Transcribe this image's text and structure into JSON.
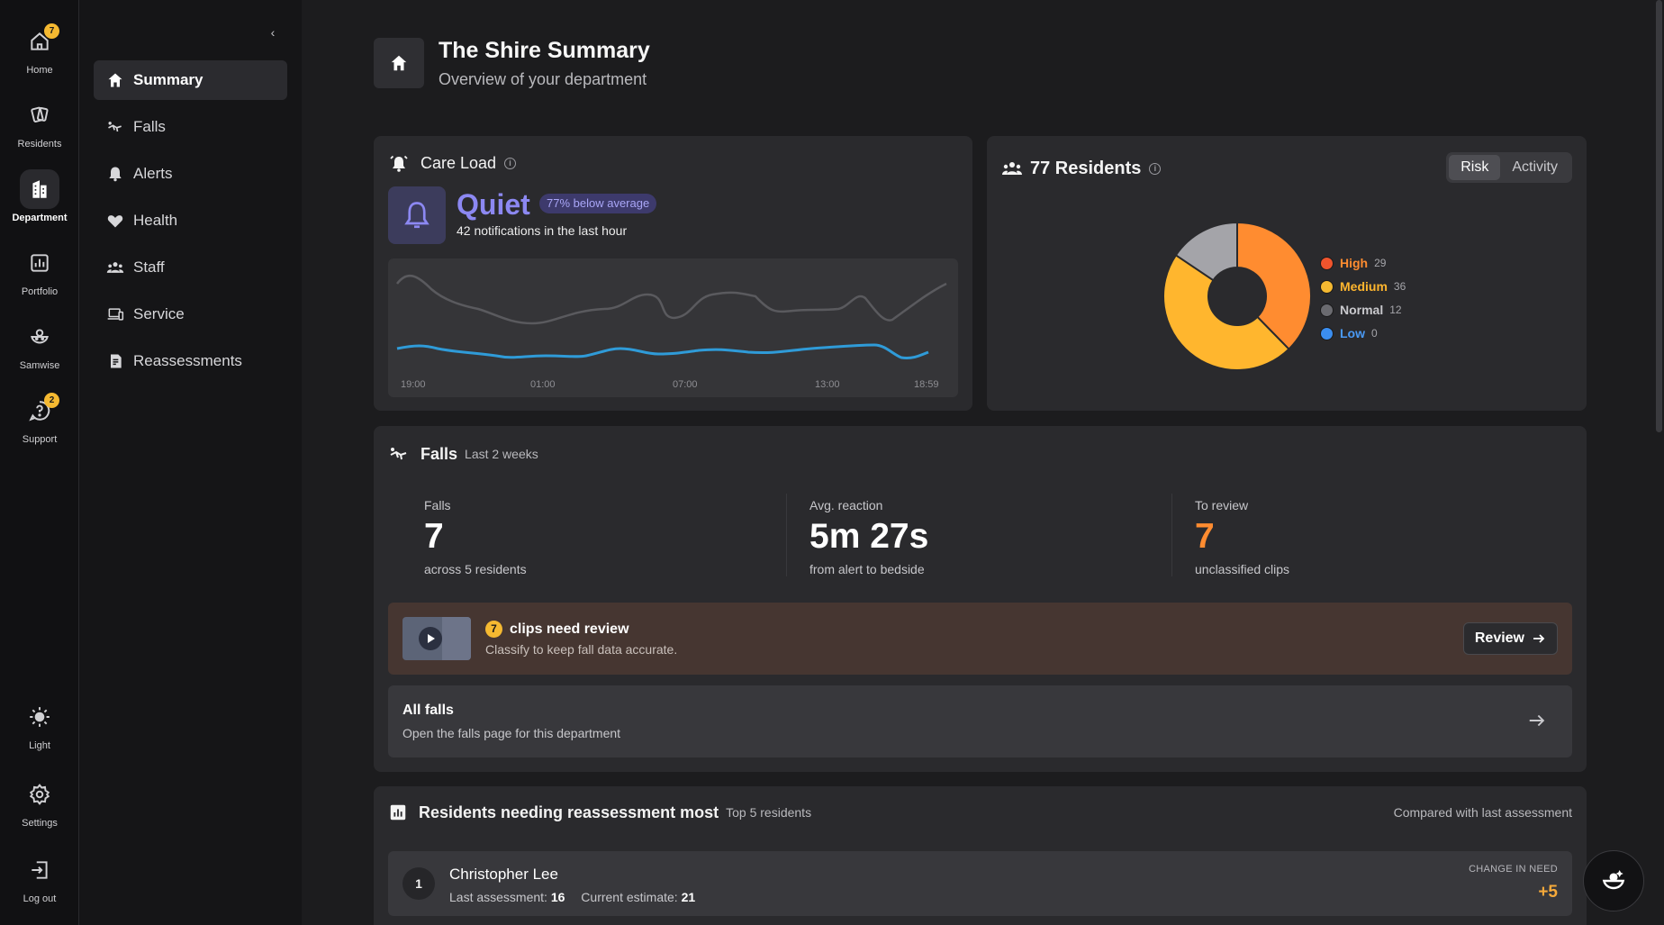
{
  "rail": {
    "home": {
      "label": "Home",
      "badge": "7"
    },
    "residents": {
      "label": "Residents"
    },
    "department": {
      "label": "Department"
    },
    "portfolio": {
      "label": "Portfolio"
    },
    "samwise": {
      "label": "Samwise"
    },
    "support": {
      "label": "Support",
      "badge": "2"
    },
    "light": {
      "label": "Light"
    },
    "settings": {
      "label": "Settings"
    },
    "logout": {
      "label": "Log out"
    }
  },
  "nav": {
    "collapse_glyph": "‹",
    "items": [
      {
        "label": "Summary",
        "icon": "home-icon",
        "active": true
      },
      {
        "label": "Falls",
        "icon": "fall-icon"
      },
      {
        "label": "Alerts",
        "icon": "bell-icon"
      },
      {
        "label": "Health",
        "icon": "heart-icon"
      },
      {
        "label": "Staff",
        "icon": "people-icon"
      },
      {
        "label": "Service",
        "icon": "devices-icon"
      },
      {
        "label": "Reassessments",
        "icon": "clipboard-icon"
      }
    ]
  },
  "header": {
    "title": "The Shire Summary",
    "subtitle": "Overview of your department",
    "icon": "home-icon"
  },
  "care_load": {
    "title": "Care Load",
    "status": "Quiet",
    "pill": "77% below average",
    "notifications": "42 notifications in the last hour",
    "ticks": [
      "19:00",
      "01:00",
      "07:00",
      "13:00",
      "18:59"
    ],
    "colors": {
      "accent": "#8c88f2",
      "line_current": "#2f9bd8",
      "line_avg": "#5a5a5e"
    }
  },
  "residents": {
    "title": "77 Residents",
    "toggle": [
      "Risk",
      "Activity"
    ],
    "selected_toggle": "Risk",
    "legend": [
      {
        "label": "High",
        "count": "29",
        "color": "#f0542d"
      },
      {
        "label": "Medium",
        "count": "36",
        "color": "#f5b931"
      },
      {
        "label": "Normal",
        "count": "12",
        "color": "#6b6b70"
      },
      {
        "label": "Low",
        "count": "0",
        "color": "#3b8ef0"
      }
    ]
  },
  "chart_data": {
    "type": "pie",
    "categories": [
      "High",
      "Medium",
      "Normal",
      "Low"
    ],
    "values": [
      29,
      36,
      12,
      0
    ],
    "colors": [
      "#ff8c30",
      "#ffb62e",
      "#a4a4a9",
      "#3b8ef0"
    ]
  },
  "falls": {
    "title": "Falls",
    "period": "Last 2 weeks",
    "stats": [
      {
        "label": "Falls",
        "value": "7",
        "sub": "across 5 residents"
      },
      {
        "label": "Avg. reaction",
        "value": "5m 27s",
        "sub": "from alert to bedside"
      },
      {
        "label": "To review",
        "value": "7",
        "sub": "unclassified clips"
      }
    ],
    "review": {
      "count": "7",
      "title": "clips need review",
      "subtitle": "Classify to keep fall data accurate.",
      "button": "Review"
    },
    "all": {
      "title": "All falls",
      "subtitle": "Open the falls page for this department"
    }
  },
  "reassessment": {
    "title": "Residents needing reassessment most",
    "scope": "Top 5 residents",
    "compare": "Compared with last assessment",
    "rows": [
      {
        "rank": "1",
        "name": "Christopher Lee",
        "last_label": "Last assessment:",
        "last": "16",
        "current_label": "Current estimate:",
        "current": "21",
        "change_label": "CHANGE IN NEED",
        "change": "+5"
      }
    ]
  }
}
